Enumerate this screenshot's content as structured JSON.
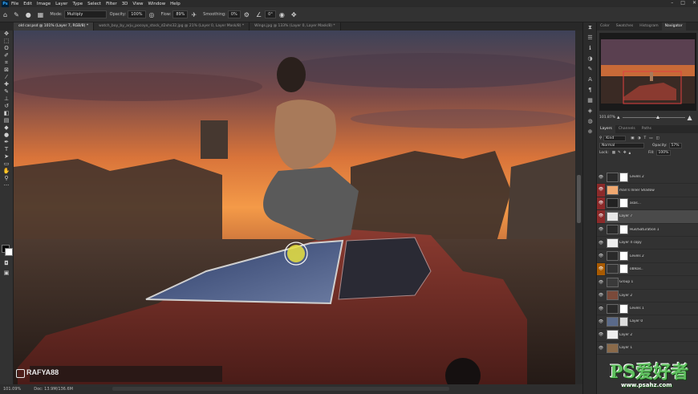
{
  "app": {
    "logo": "Ps"
  },
  "menubar": {
    "items": [
      "File",
      "Edit",
      "Image",
      "Layer",
      "Type",
      "Select",
      "Filter",
      "3D",
      "View",
      "Window",
      "Help"
    ]
  },
  "options_bar": {
    "mode_label": "Mode:",
    "mode_value": "Multiply",
    "opacity_label": "Opacity:",
    "opacity_value": "100%",
    "flow_label": "Flow:",
    "flow_value": "89%",
    "smoothing_label": "Smoothing:",
    "smoothing_value": "0%",
    "angle_value": "0°"
  },
  "tabs": [
    {
      "label": "old car.psd @ 101% (Layer 7, RGB/8) *",
      "active": true
    },
    {
      "label": "watch_boy_by_arju_pocoyo_stock_d2xhs32.jpg @ 21% (Layer 0, Layer Mask/8) *",
      "active": false
    },
    {
      "label": "Wings.jpg @ 133% (Layer 0, Layer Mask/8) *",
      "active": false
    }
  ],
  "status": {
    "zoom": "101.09%",
    "doc": "Doc: 13.9M/136.6M"
  },
  "right_tabs": [
    "Color",
    "Swatches",
    "Histogram",
    "Navigator"
  ],
  "navigator": {
    "zoom": "101.87%"
  },
  "layers_panel": {
    "tabs": [
      "Layers",
      "Channels",
      "Paths"
    ],
    "kind": "Kind",
    "blend": "Normal",
    "opacity_label": "Opacity:",
    "opacity": "57%",
    "lock_label": "Lock:",
    "fill_label": "Fill:",
    "fill": "100%",
    "layers": [
      {
        "name": "Levels 2",
        "vis": "eye",
        "t1": "#2a2a2a",
        "t2": "#ffffff"
      },
      {
        "name": "man's Inner Shadow",
        "vis": "red",
        "t1": "#f0a870",
        "t2": ""
      },
      {
        "name": "asas...",
        "vis": "red",
        "t1": "#222222",
        "t2": "#ffffff"
      },
      {
        "name": "Layer 7",
        "vis": "red",
        "t1": "#e8e8e8",
        "t2": "",
        "selected": true
      },
      {
        "name": "Hue/Saturation 1",
        "vis": "eye",
        "t1": "#2a2a2a",
        "t2": "#ffffff"
      },
      {
        "name": "Layer 4 copy",
        "vis": "eye",
        "t1": "#eeeeee",
        "t2": ""
      },
      {
        "name": "Levels 2",
        "vis": "eye",
        "t1": "#2a2a2a",
        "t2": "#ffffff"
      },
      {
        "name": "oblkas..",
        "vis": "orange",
        "t1": "#333333",
        "t2": "#ffffff"
      },
      {
        "name": "Group 1",
        "vis": "eye",
        "t1": "#3a3a3a",
        "t2": ""
      },
      {
        "name": "Layer 2",
        "vis": "eye",
        "t1": "#7a4a3a",
        "t2": ""
      },
      {
        "name": "Levels 1",
        "vis": "eye",
        "t1": "#2a2a2a",
        "t2": "#ffffff"
      },
      {
        "name": "Layer 0",
        "vis": "eye",
        "t1": "#5a6a8a",
        "t2": "#dddddd"
      },
      {
        "name": "Layer 2",
        "vis": "eye",
        "t1": "#eeeeee",
        "t2": ""
      },
      {
        "name": "Layer 1",
        "vis": "eye",
        "t1": "#8a6a4a",
        "t2": ""
      }
    ]
  },
  "canvas_overlay": {
    "handle": "RAFYA88"
  },
  "watermark": {
    "main": "PS爱好者",
    "url": "www.psahz.com"
  },
  "colors": {
    "accent": "#31a8ff",
    "selection_red": "#8b2a2a",
    "sky_orange": "#f08a3a"
  }
}
